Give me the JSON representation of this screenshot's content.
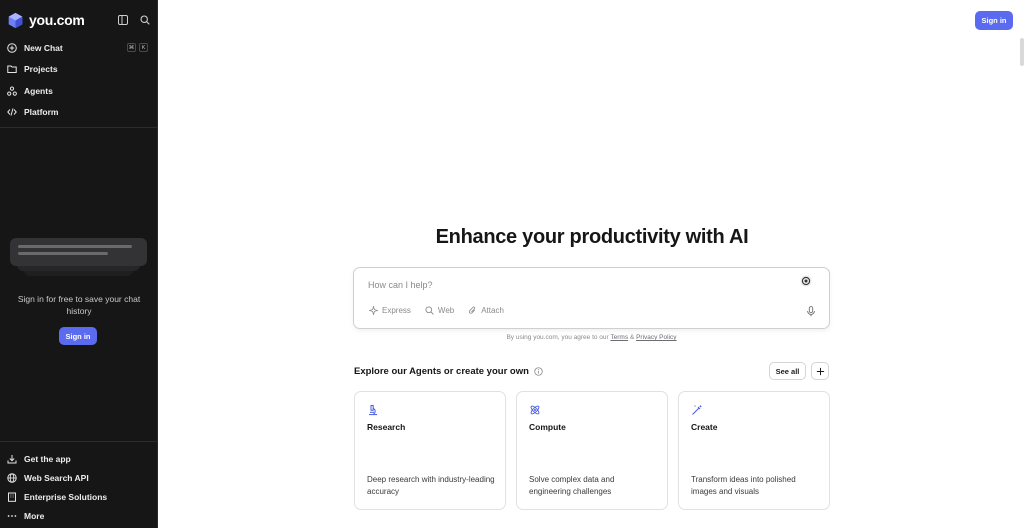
{
  "sidebar": {
    "logo_text": "you.com",
    "nav": [
      {
        "label": "New Chat",
        "icon": "plus-circle-icon"
      },
      {
        "label": "Projects",
        "icon": "folder-icon"
      },
      {
        "label": "Agents",
        "icon": "agents-icon"
      },
      {
        "label": "Platform",
        "icon": "code-icon"
      }
    ],
    "shortcut_keys": [
      "⌘",
      "K"
    ],
    "signin_prompt": "Sign in for free to save your chat history",
    "signin_label": "Sign in",
    "bottom_nav": [
      {
        "label": "Get the app",
        "icon": "download-icon"
      },
      {
        "label": "Web Search API",
        "icon": "globe-icon"
      },
      {
        "label": "Enterprise Solutions",
        "icon": "building-icon"
      },
      {
        "label": "More",
        "icon": "more-icon"
      }
    ]
  },
  "header": {
    "signin_label": "Sign in"
  },
  "main": {
    "title": "Enhance your productivity with AI",
    "chat": {
      "placeholder": "How can I help?",
      "tools": [
        {
          "label": "Express",
          "icon": "sparkle-icon"
        },
        {
          "label": "Web",
          "icon": "search-icon"
        },
        {
          "label": "Attach",
          "icon": "paperclip-icon"
        }
      ]
    },
    "terms": {
      "prefix": "By using you.com, you agree to our ",
      "terms_link": "Terms",
      "amp": " & ",
      "privacy_link": "Privacy Policy"
    },
    "explore": {
      "title": "Explore our Agents or create your own",
      "see_all": "See all"
    },
    "cards": [
      {
        "title": "Research",
        "desc": "Deep research with industry-leading accuracy",
        "icon": "microscope-icon"
      },
      {
        "title": "Compute",
        "desc": "Solve complex data and engineering challenges",
        "icon": "atom-icon"
      },
      {
        "title": "Create",
        "desc": "Transform ideas into polished images and visuals",
        "icon": "magic-wand-icon"
      }
    ]
  },
  "colors": {
    "accent": "#5a6bf0",
    "sidebar_bg": "#161617"
  }
}
